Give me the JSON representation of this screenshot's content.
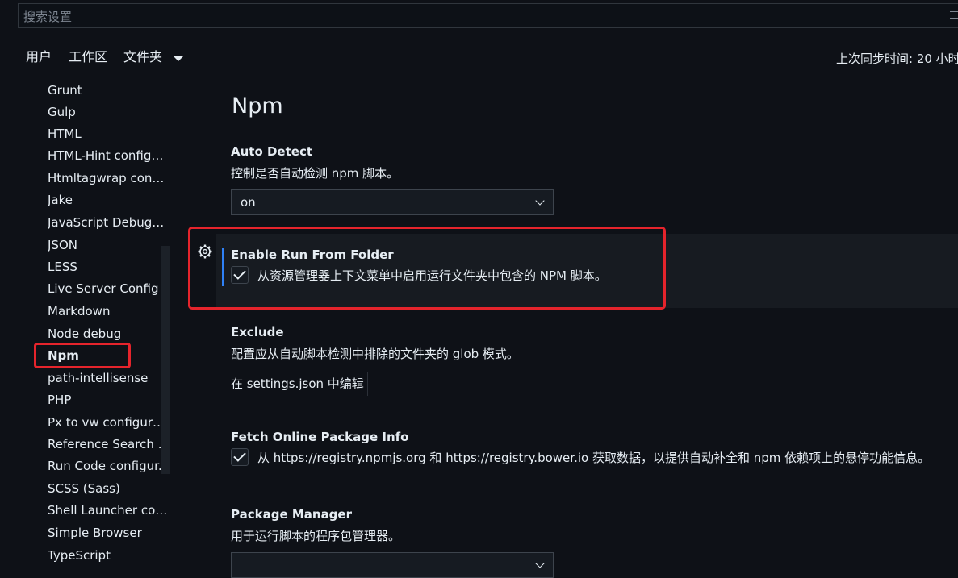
{
  "search": {
    "placeholder": "搜索设置",
    "filter_icon": "filter-list-icon"
  },
  "tabs": {
    "user": "用户",
    "workspace": "工作区",
    "folder": "文件夹",
    "folder_icon": "chevron-down-icon"
  },
  "sync_status": "上次同步时间: 20 小时",
  "toc": {
    "items": [
      "Grunt",
      "Gulp",
      "HTML",
      "HTML-Hint configu...",
      "Htmltagwrap confi...",
      "Jake",
      "JavaScript Debugger",
      "JSON",
      "LESS",
      "Live Server Config",
      "Markdown",
      "Node debug",
      "Npm",
      "path-intellisense",
      "PHP",
      "Px to vw configurat...",
      "Reference Search V...",
      "Run Code configur...",
      "SCSS (Sass)",
      "Shell Launcher conf...",
      "Simple Browser",
      "TypeScript"
    ],
    "active": "Npm"
  },
  "section": {
    "title": "Npm"
  },
  "settings": {
    "auto_detect": {
      "title": "Auto Detect",
      "description": "控制是否自动检测 npm 脚本。",
      "value": "on"
    },
    "run_from_folder": {
      "title": "Enable Run From Folder",
      "label": "从资源管理器上下文菜单中启用运行文件夹中包含的 NPM 脚本。",
      "checked": true,
      "gear_icon": "gear-icon"
    },
    "exclude": {
      "title": "Exclude",
      "description": "配置应从自动脚本检测中排除的文件夹的 glob 模式。",
      "link": "在 settings.json 中编辑"
    },
    "fetch_info": {
      "title": "Fetch Online Package Info",
      "label": "从 https://registry.npmjs.org 和 https://registry.bower.io 获取数据，以提供自动补全和 npm 依赖项上的悬停功能信息。",
      "checked": true
    },
    "package_manager": {
      "title": "Package Manager",
      "description": "用于运行脚本的程序包管理器。"
    }
  },
  "colors": {
    "background": "#0e1117",
    "highlight": "#e5242c",
    "focus": "#2f81f7"
  }
}
